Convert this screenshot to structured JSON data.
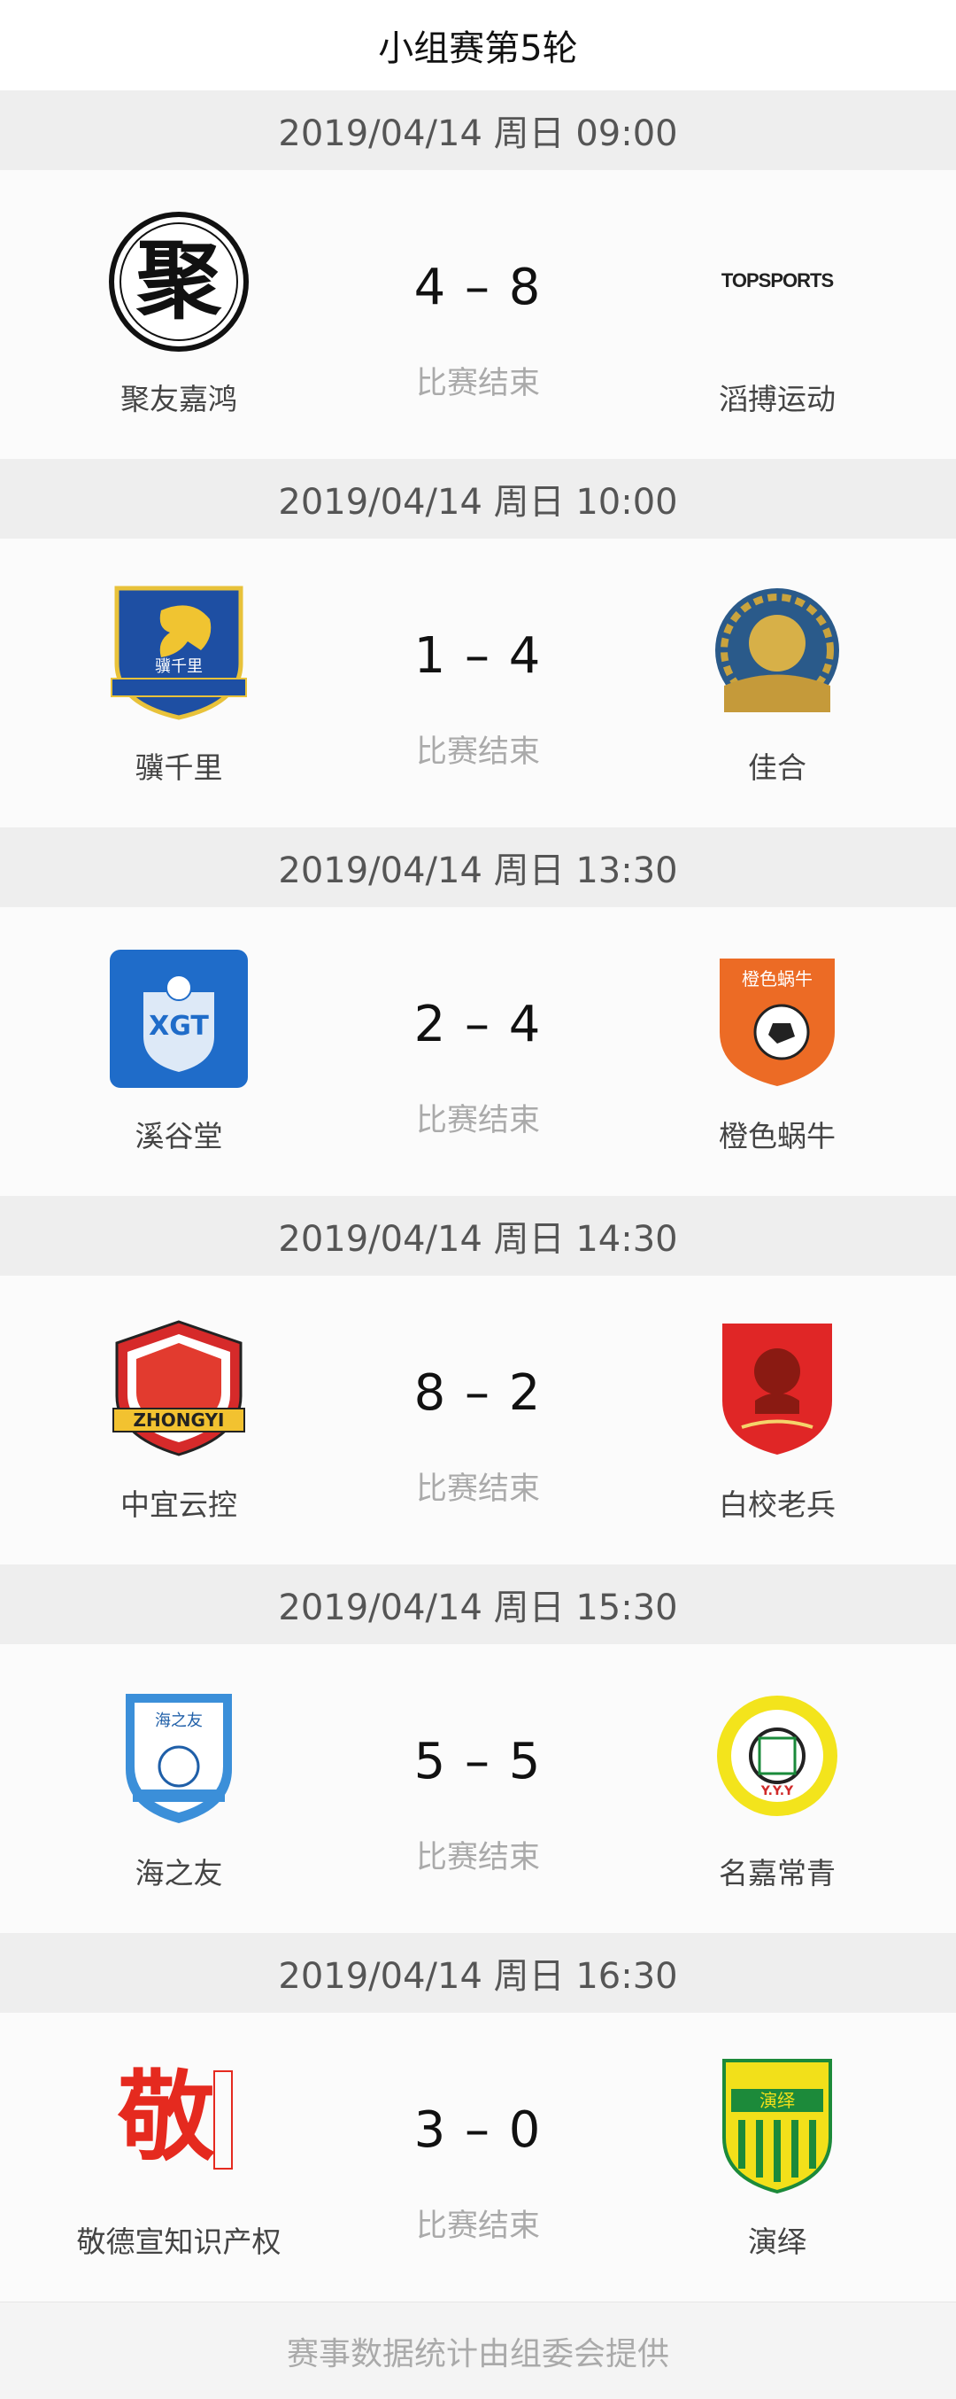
{
  "header": {
    "title": "小组赛第5轮"
  },
  "matches": [
    {
      "datetime": "2019/04/14 周日 09:00",
      "home": {
        "name": "聚友嘉鸿",
        "logo": "ju-calligraphy-logo"
      },
      "away": {
        "name": "滔搏运动",
        "logo": "topsports-text-logo",
        "logo_text": "TOPSPORTS"
      },
      "score": "4 – 8",
      "status": "比赛结束"
    },
    {
      "datetime": "2019/04/14 周日 10:00",
      "home": {
        "name": "骥千里",
        "logo": "horse-shield-logo",
        "logo_text": "骥千里"
      },
      "away": {
        "name": "佳合",
        "logo": "ornate-round-logo"
      },
      "score": "1 – 4",
      "status": "比赛结束"
    },
    {
      "datetime": "2019/04/14 周日 13:30",
      "home": {
        "name": "溪谷堂",
        "logo": "xgt-blue-square-logo",
        "logo_text": "XGT"
      },
      "away": {
        "name": "橙色蜗牛",
        "logo": "orange-snail-shield-logo",
        "logo_text": "橙色蜗牛"
      },
      "score": "2 – 4",
      "status": "比赛结束"
    },
    {
      "datetime": "2019/04/14 周日 14:30",
      "home": {
        "name": "中宜云控",
        "logo": "zhongyi-shield-logo",
        "logo_text": "ZHONGYI"
      },
      "away": {
        "name": "白校老兵",
        "logo": "red-portrait-shield-logo"
      },
      "score": "8 – 2",
      "status": "比赛结束"
    },
    {
      "datetime": "2019/04/14 周日 15:30",
      "home": {
        "name": "海之友",
        "logo": "blue-floral-shield-logo",
        "logo_text": "海之友"
      },
      "away": {
        "name": "名嘉常青",
        "logo": "yellow-round-badge-logo",
        "logo_text": "Y.Y.Y"
      },
      "score": "5 – 5",
      "status": "比赛结束"
    },
    {
      "datetime": "2019/04/14 周日 16:30",
      "home": {
        "name": "敬德宣知识产权",
        "logo": "jing-red-seal-logo",
        "logo_text": "敬"
      },
      "away": {
        "name": "演绎",
        "logo": "yanyi-green-shield-logo",
        "logo_text": "演绎"
      },
      "score": "3 – 0",
      "status": "比赛结束"
    }
  ],
  "footer": {
    "text": "赛事数据统计由组委会提供"
  },
  "colors": {
    "date_bar_bg": "#eeeeee",
    "status_text": "#aaaaaa"
  }
}
